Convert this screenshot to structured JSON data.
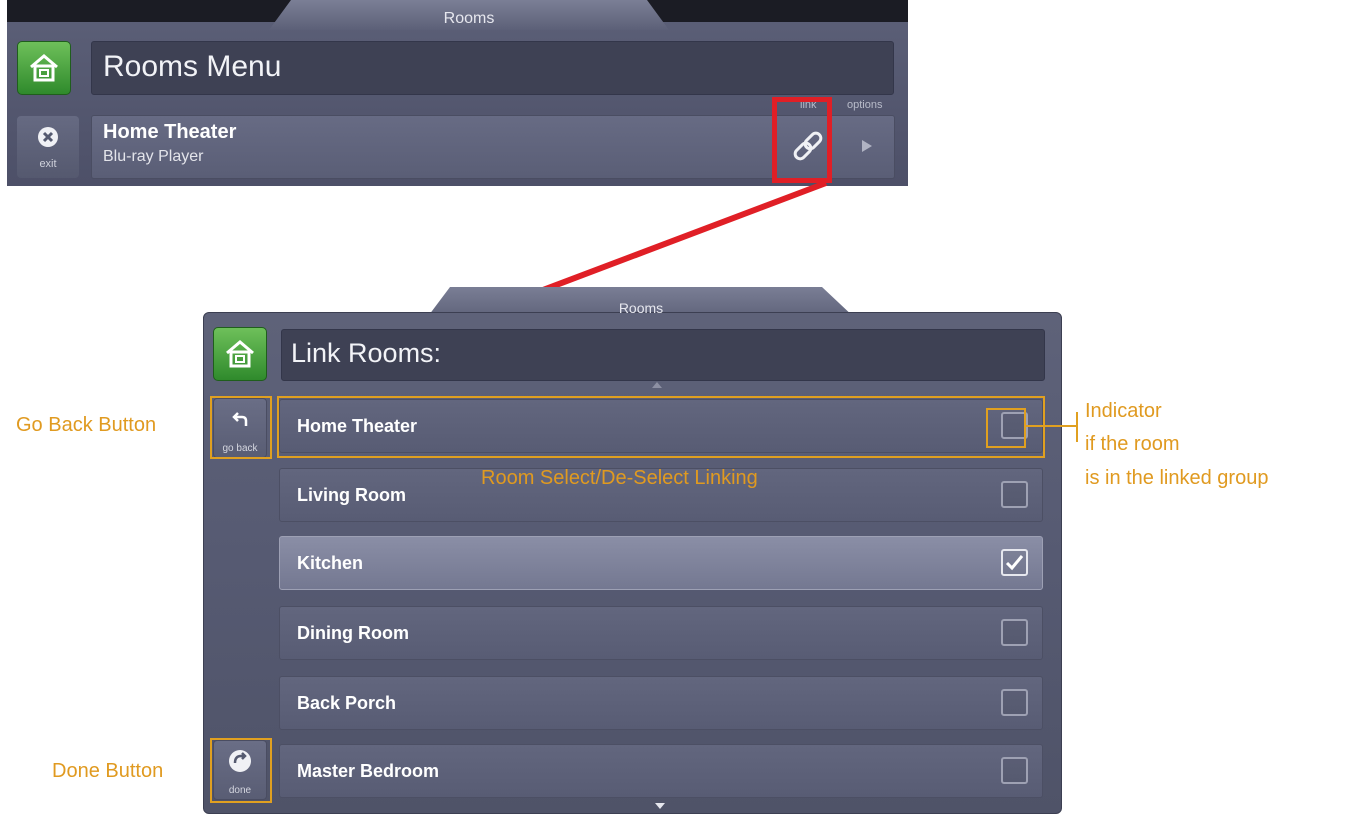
{
  "top_panel": {
    "tab_title": "Rooms",
    "title": "Rooms Menu",
    "exit_label": "exit",
    "room_name": "Home Theater",
    "room_source": "Blu-ray Player",
    "link_label": "link",
    "options_label": "options"
  },
  "main_panel": {
    "tab_title": "Rooms",
    "title": "Link Rooms:",
    "go_back_label": "go back",
    "done_label": "done",
    "rooms": [
      {
        "label": "Home Theater",
        "checked": false
      },
      {
        "label": "Living Room",
        "checked": false
      },
      {
        "label": "Kitchen",
        "checked": true
      },
      {
        "label": "Dining Room",
        "checked": false
      },
      {
        "label": "Back Porch",
        "checked": false
      },
      {
        "label": "Master Bedroom",
        "checked": false
      }
    ]
  },
  "annotations": {
    "go_back": "Go Back Button",
    "done": "Done Button",
    "room_select": "Room Select/De-Select Linking",
    "indicator_line1": "Indicator",
    "indicator_line2": "if the room",
    "indicator_line3": "is in the linked group"
  },
  "colors": {
    "accent_green": "#3a9a33",
    "annotation_orange": "#e0a020",
    "highlight_red": "#e01f26",
    "panel_bg": "#5a5e76"
  }
}
